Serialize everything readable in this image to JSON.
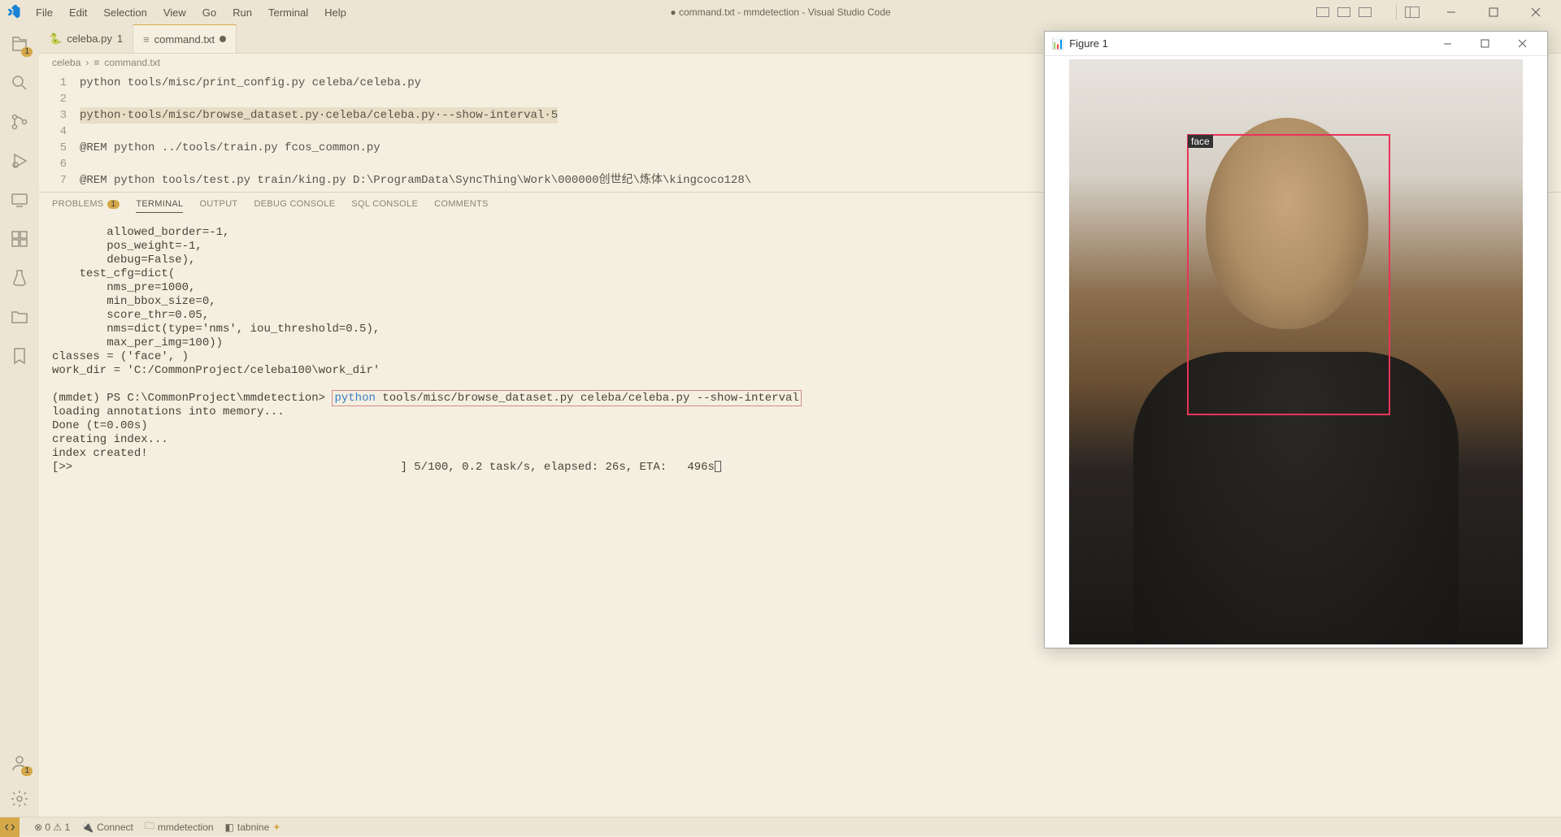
{
  "menubar": [
    "File",
    "Edit",
    "Selection",
    "View",
    "Go",
    "Run",
    "Terminal",
    "Help"
  ],
  "window_title": "● command.txt - mmdetection - Visual Studio Code",
  "activity_badges": {
    "explorer": "1",
    "accounts": "1"
  },
  "tabs": [
    {
      "label": "celeba.py",
      "suffix": "1",
      "modified": false,
      "icon": "python"
    },
    {
      "label": "command.txt",
      "suffix": "",
      "modified": true,
      "icon": "text"
    }
  ],
  "breadcrumb": [
    "celeba",
    "command.txt"
  ],
  "code": {
    "lines": [
      "python tools/misc/print_config.py celeba/celeba.py",
      "",
      "python·tools/misc/browse_dataset.py·celeba/celeba.py·--show-interval·5",
      "",
      "@REM python ../tools/train.py fcos_common.py",
      "",
      "@REM python tools/test.py train/king.py D:\\ProgramData\\SyncThing\\Work\\000000创世纪\\炼体\\kingcoco128\\"
    ],
    "selected_line_index": 2
  },
  "panel_tabs": {
    "problems": "PROBLEMS",
    "problems_badge": "1",
    "terminal": "TERMINAL",
    "output": "OUTPUT",
    "debug": "DEBUG CONSOLE",
    "sql": "SQL CONSOLE",
    "comments": "COMMENTS"
  },
  "terminal": {
    "config_block": "        allowed_border=-1,\n        pos_weight=-1,\n        debug=False),\n    test_cfg=dict(\n        nms_pre=1000,\n        min_bbox_size=0,\n        score_thr=0.05,\n        nms=dict(type='nms', iou_threshold=0.5),\n        max_per_img=100))\nclasses = ('face', )\nwork_dir = 'C:/CommonProject/celeba100\\work_dir'",
    "prompt_prefix": "(mmdet) PS C:\\CommonProject\\mmdetection> ",
    "prompt_cmd_py": "python",
    "prompt_cmd_rest": " tools/misc/browse_dataset.py celeba/celeba.py --show-interval",
    "loading": "loading annotations into memory...\nDone (t=0.00s)\ncreating index...\nindex created!",
    "progress": "[>>                                                ] 5/100, 0.2 task/s, elapsed: 26s, ETA:   496s"
  },
  "statusbar": {
    "errwarn": "⊗ 0 ⚠ 1",
    "connect": "Connect",
    "folder": "mmdetection",
    "tabnine": "tabnine"
  },
  "figure": {
    "title": "Figure 1",
    "bbox_label": "face"
  }
}
